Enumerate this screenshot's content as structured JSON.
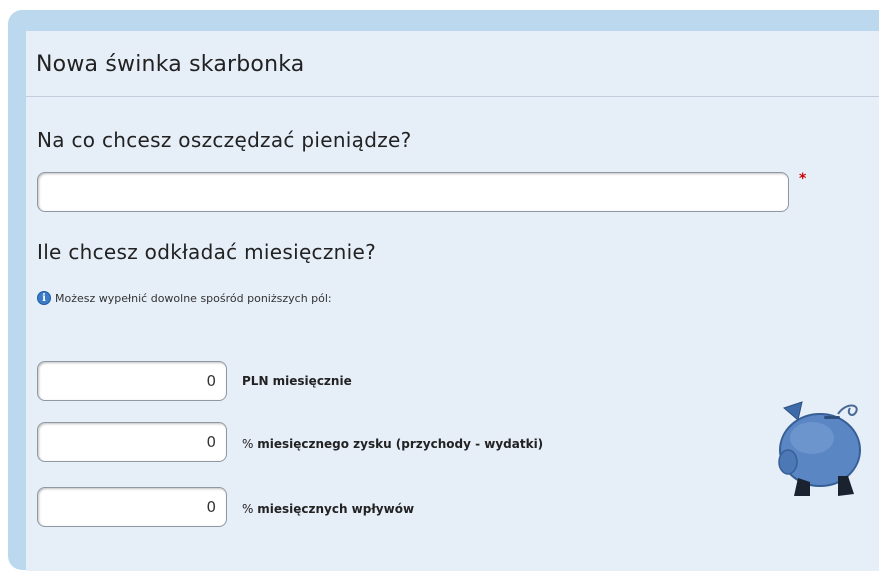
{
  "header": {
    "title": "Nowa świnka skarbonka"
  },
  "goal": {
    "question": "Na co chcesz oszczędzać pieniądze?",
    "value": "",
    "required_marker": "*"
  },
  "monthly": {
    "question": "Ile chcesz odkładać miesięcznie?",
    "info_icon": "info-icon",
    "info_text": "Możesz wypełnić dowolne spośród poniższych pól:",
    "fields": [
      {
        "value": "0",
        "prefix": "",
        "label": "PLN miesięcznie"
      },
      {
        "value": "0",
        "prefix": "% ",
        "label": "miesięcznego zysku (przychody - wydatki)"
      },
      {
        "value": "0",
        "prefix": "% ",
        "label": "miesięcznych wpływów"
      }
    ]
  },
  "decor": {
    "image": "piggy-bank-icon"
  },
  "colors": {
    "frame": "#bcd8ee",
    "panel": "#e6eef8",
    "required": "#cc0000",
    "pig": "#5b86c4"
  }
}
